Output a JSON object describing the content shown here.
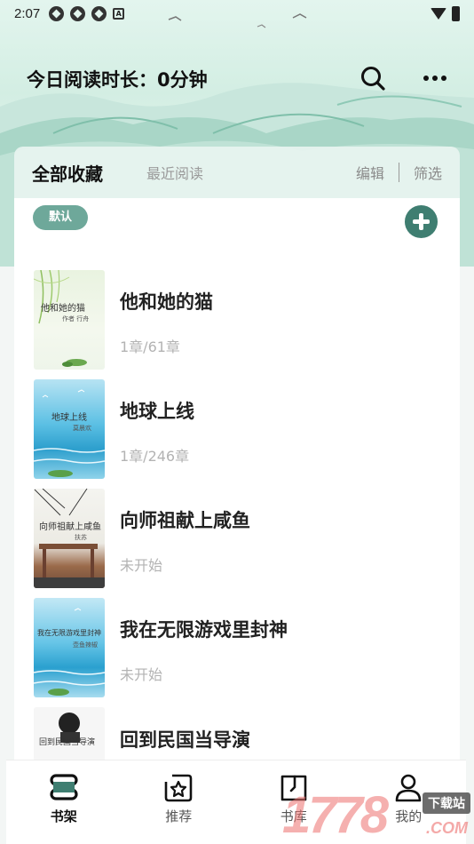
{
  "status_bar": {
    "time": "2:07",
    "a_badge": "A"
  },
  "header": {
    "reading_time": "今日阅读时长：0分钟",
    "icons": [
      "search-icon",
      "more-icon"
    ]
  },
  "tabs": {
    "all": "全部收藏",
    "recent": "最近阅读",
    "edit": "编辑",
    "filter": "筛选"
  },
  "tag": {
    "label": "默认"
  },
  "books": [
    {
      "title": "他和她的猫",
      "progress": "1章/61章",
      "cover_title": "他和她的猫",
      "cover_author": "作者 行舟"
    },
    {
      "title": "地球上线",
      "progress": "1章/246章",
      "cover_title": "地球上线",
      "cover_author": "莫晨欢"
    },
    {
      "title": "向师祖献上咸鱼",
      "progress": "未开始",
      "cover_title": "向师祖献上咸鱼",
      "cover_author": "扶苏"
    },
    {
      "title": "我在无限游戏里封神",
      "progress": "未开始",
      "cover_title": "我在无限游戏里封神",
      "cover_author": "壶鱼辣椒"
    },
    {
      "title": "回到民国当导演",
      "progress": "",
      "cover_title": "回到民国当导演",
      "cover_author": ""
    }
  ],
  "bottom_nav": [
    {
      "label": "书架",
      "icon": "bookshelf-icon",
      "active": true
    },
    {
      "label": "推荐",
      "icon": "recommend-icon",
      "active": false
    },
    {
      "label": "书库",
      "icon": "library-icon",
      "active": false
    },
    {
      "label": "我的",
      "icon": "profile-icon",
      "active": false
    }
  ],
  "watermark": {
    "number": "1778",
    "site": "下载站",
    "com": ".COM"
  },
  "colors": {
    "accent": "#3f7e71",
    "tag": "#6ea89a",
    "background": "#f3f6f5"
  }
}
